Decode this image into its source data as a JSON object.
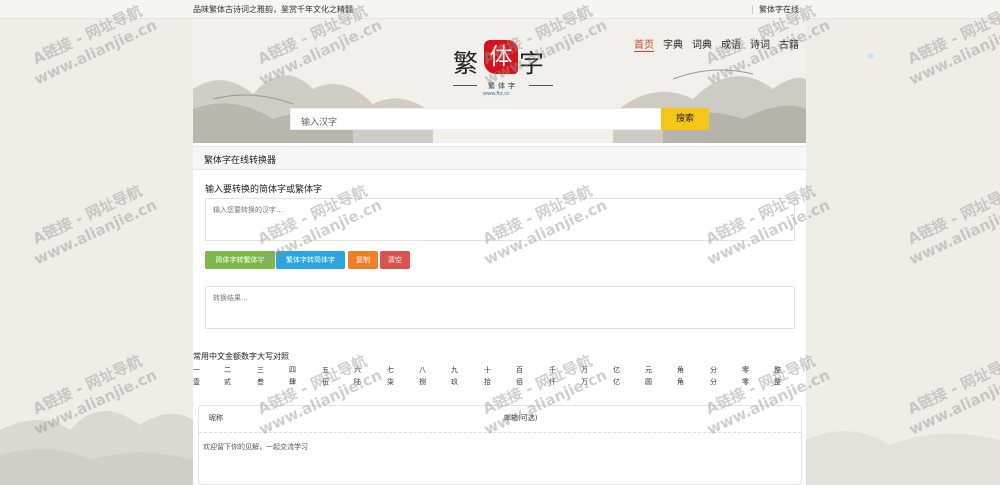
{
  "topbar": {
    "slogan": "品味繁体古诗词之雅韵，鉴赏千年文化之精髓",
    "site_link": "繁体字在线"
  },
  "logo": {
    "char_left": "繁",
    "char_seal": "体",
    "char_right": "字",
    "subtitle": "繁体字",
    "domain": "www.ftz.cc"
  },
  "nav": {
    "items": [
      "首页",
      "字典",
      "词典",
      "成语",
      "诗词",
      "古籍"
    ],
    "active_index": 0
  },
  "search": {
    "placeholder": "输入汉字",
    "button": "搜索"
  },
  "converter": {
    "panel_title": "繁体字在线转换器",
    "input_label": "输入要转换的简体字或繁体字",
    "input_placeholder": "输入您要转换的汉字...",
    "buttons": {
      "s2t": "简体字转繁体字",
      "t2s": "繁体字转简体字",
      "copy": "复制",
      "clear": "清空"
    },
    "output_placeholder": "转换结果..."
  },
  "money_table": {
    "title": "常用中文金额数字大写对照",
    "simple": [
      "一",
      "二",
      "三",
      "四",
      "五",
      "六",
      "七",
      "八",
      "九",
      "十",
      "百",
      "千",
      "万",
      "亿",
      "元",
      "角",
      "分",
      "零",
      "整"
    ],
    "traditional": [
      "壹",
      "贰",
      "叁",
      "肆",
      "伍",
      "陆",
      "柒",
      "捌",
      "玖",
      "拾",
      "佰",
      "仟",
      "万",
      "亿",
      "圆",
      "角",
      "分",
      "零",
      "整"
    ]
  },
  "comment": {
    "nick_label": "昵称",
    "mail_label": "邮箱(可选)",
    "placeholder": "欢迎留下你的见解，一起交流学习"
  },
  "watermark": {
    "line1": "A链接 - 网址导航",
    "line2": "www.alianjie.cn"
  },
  "colors": {
    "accent_nav": "#c9461e",
    "search_button": "#f5c518",
    "btn_s2t": "#7cba4a",
    "btn_t2s": "#2aa5de",
    "btn_copy": "#f07f2a",
    "btn_clear": "#d9534f",
    "seal_red": "#d4141a"
  }
}
